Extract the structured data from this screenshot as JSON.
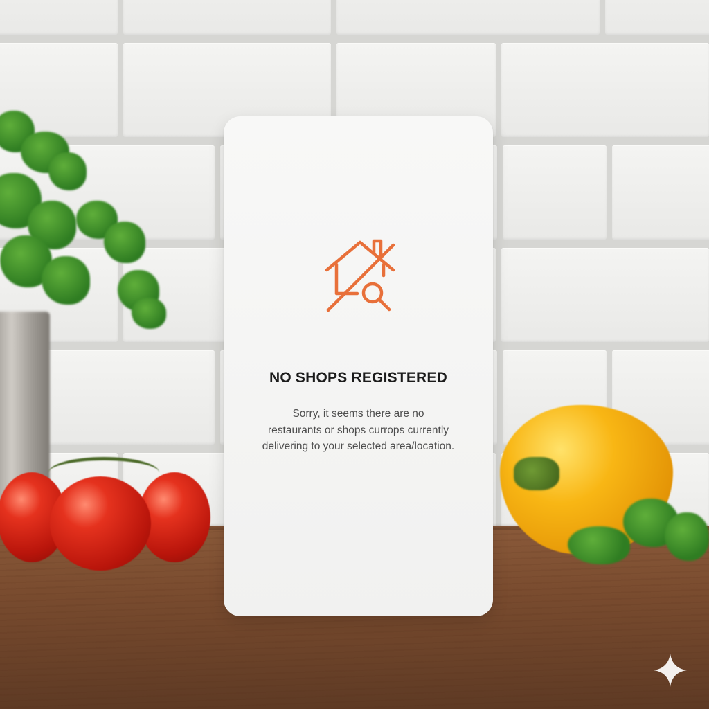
{
  "empty_state": {
    "title": "NO SHOPS REGISTERED",
    "message_lines": [
      "Sorry, it seems there are no",
      "restaurants or shops currops currently",
      "delivering to your selected area/location."
    ],
    "icon": "house-search-unavailable-icon",
    "accent_color": "#e8703a"
  },
  "background": {
    "scene": "kitchen-counter",
    "decor_icons": [
      "parsley",
      "tomatoes",
      "yellow-pepper"
    ]
  },
  "watermark": {
    "icon": "sparkle-icon",
    "color": "#ffffff"
  }
}
